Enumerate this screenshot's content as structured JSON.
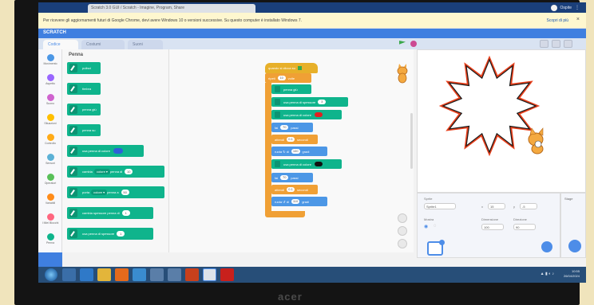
{
  "browser": {
    "tab_title": "Scratch 3.0 GUI / Scratch - Imagine, Program, Share",
    "user_name": "Ospite"
  },
  "notice": {
    "text": "Per ricevere gli aggiornamenti futuri di Google Chrome, devi avere Windows 10 o versioni successive. Su questo computer è installato Windows 7.",
    "link": "Scopri di più",
    "close": "×"
  },
  "scratch": {
    "logo": "SCRATCH",
    "tabs": {
      "code": "Codice",
      "costumes": "Costumi",
      "sounds": "Suoni"
    }
  },
  "categories": [
    {
      "label": "Movimento",
      "color": "#4c97e6"
    },
    {
      "label": "Aspetto",
      "color": "#9966ff"
    },
    {
      "label": "Suono",
      "color": "#cf63cf"
    },
    {
      "label": "Situazioni",
      "color": "#ffbf00"
    },
    {
      "label": "Controllo",
      "color": "#ffab19"
    },
    {
      "label": "Sensori",
      "color": "#5cb1d6"
    },
    {
      "label": "Operatori",
      "color": "#59c059"
    },
    {
      "label": "Variabili",
      "color": "#ff8c1a"
    },
    {
      "label": "I Miei Blocchi",
      "color": "#ff6680"
    },
    {
      "label": "Penna",
      "color": "#0fb48c"
    }
  ],
  "palette": {
    "title": "Penna",
    "blocks": [
      {
        "text": "pulisci"
      },
      {
        "text": "timbra"
      },
      {
        "text": "penna giù"
      },
      {
        "text": "penna su"
      },
      {
        "text": "usa penna di colore",
        "swatch": "#2e60d8"
      },
      {
        "text": "cambia",
        "dropdown": "colore ▾",
        "suffix": "penna di",
        "value": "10"
      },
      {
        "text": "porta",
        "dropdown": "colore ▾",
        "suffix": "penna a",
        "value": "50"
      },
      {
        "text": "cambia spessore penna di",
        "value": "1"
      },
      {
        "text": "usa penna di spessore",
        "value": "1"
      }
    ]
  },
  "script": {
    "hat": "quando si clicca su",
    "repeat": {
      "label": "ripeti",
      "value": "10",
      "suffix": "volte"
    },
    "pen_down": "penna giù",
    "pen_size": {
      "label": "usa penna di spessore",
      "value": "3"
    },
    "pen_color_red": {
      "label": "usa penna di colore",
      "color": "#e02020"
    },
    "move1": {
      "label": "fai",
      "value": "70",
      "suffix": "passi"
    },
    "wait1": {
      "label": "attendi",
      "value": "0.1",
      "suffix": "secondi"
    },
    "turn_right": {
      "label": "ruota ↻ di",
      "value": "100",
      "suffix": "gradi"
    },
    "pen_color_black": {
      "label": "usa penna di colore",
      "color": "#111111"
    },
    "move2": {
      "label": "fai",
      "value": "70",
      "suffix": "passi"
    },
    "wait2": {
      "label": "attendi",
      "value": "0.1",
      "suffix": "secondi"
    },
    "turn_left": {
      "label": "ruota ↺ di",
      "value": "110",
      "suffix": "gradi"
    }
  },
  "sprite_info": {
    "sprite_label": "Sprite",
    "sprite_name": "Sprite1",
    "x_label": "x",
    "x_value": "15",
    "y_label": "y",
    "y_value": "-5",
    "show_label": "Mostra",
    "size_label": "Dimensione",
    "size_value": "100",
    "direction_label": "Direzione",
    "direction_value": "90"
  },
  "backdrop": {
    "label": "Stage"
  },
  "taskbar": {
    "time": "10:55",
    "date": "26/04/2024"
  },
  "monitor": {
    "brand": "acer"
  },
  "colors": {
    "stage_star_outer": "#e8401c",
    "stage_star_inner": "#1a1a1a"
  }
}
